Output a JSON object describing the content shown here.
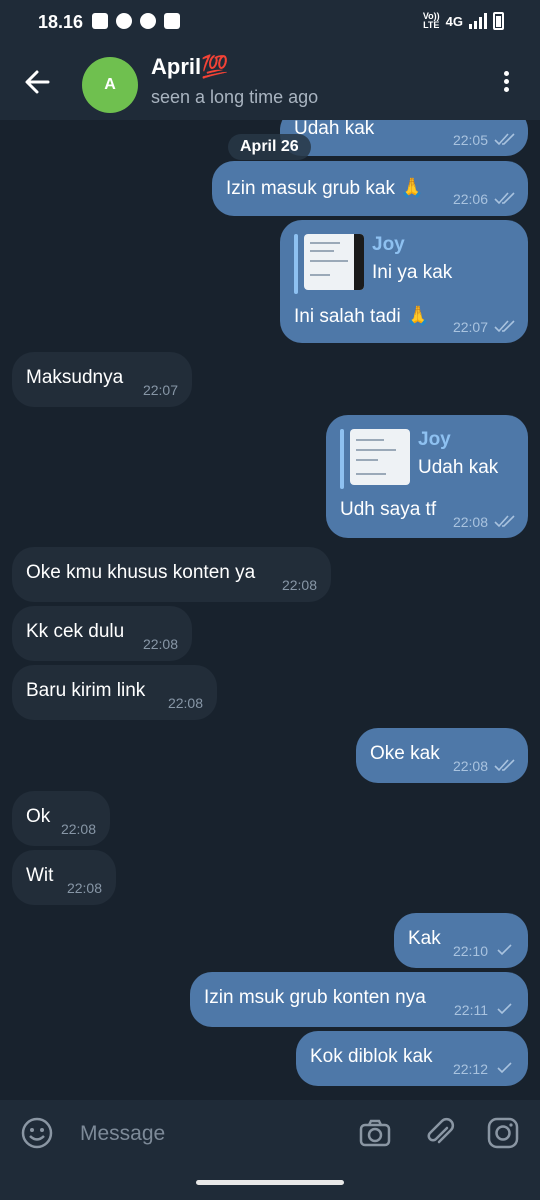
{
  "status_bar": {
    "time": "18.16",
    "volte_top": "Vo))",
    "volte_bottom": "LTE",
    "network": "4G"
  },
  "header": {
    "name": "April💯",
    "avatar_letter": "A",
    "avatar_color": "#6fc04f",
    "status": "seen a long time ago"
  },
  "chat": {
    "date_chip": "April 26",
    "messages": [
      {
        "dir": "out",
        "text": "Udah kak",
        "time": "22:05",
        "status": "read"
      },
      {
        "dir": "out",
        "text": "Izin masuk grub kak 🙏",
        "time": "22:06",
        "status": "read"
      },
      {
        "dir": "out",
        "reply_name": "Joy",
        "reply_text": "Ini ya kak",
        "text": "Ini salah tadi 🙏",
        "time": "22:07",
        "status": "read"
      },
      {
        "dir": "in",
        "text": "Maksudnya",
        "time": "22:07"
      },
      {
        "dir": "out",
        "reply_name": "Joy",
        "reply_text": "Udah kak",
        "text": "Udh saya tf",
        "time": "22:08",
        "status": "read"
      },
      {
        "dir": "in",
        "text": "Oke kmu khusus konten ya",
        "time": "22:08"
      },
      {
        "dir": "in",
        "text": "Kk cek dulu",
        "time": "22:08"
      },
      {
        "dir": "in",
        "text": "Baru kirim link",
        "time": "22:08"
      },
      {
        "dir": "out",
        "text": "Oke kak",
        "time": "22:08",
        "status": "read"
      },
      {
        "dir": "in",
        "text": "Ok",
        "time": "22:08"
      },
      {
        "dir": "in",
        "text": "Wit",
        "time": "22:08"
      },
      {
        "dir": "out",
        "text": "Kak",
        "time": "22:10",
        "status": "sent"
      },
      {
        "dir": "out",
        "text": "Izin msuk grub konten nya",
        "time": "22:11",
        "status": "sent"
      },
      {
        "dir": "out",
        "text": "Kok diblok kak",
        "time": "22:12",
        "status": "sent"
      }
    ]
  },
  "composer": {
    "placeholder": "Message"
  },
  "colors": {
    "background": "#18222d",
    "bar": "#1f2b38",
    "outgoing_bubble": "#4e78a8",
    "incoming_bubble": "#222d39",
    "accent": "#8ec1f1"
  },
  "icons": {
    "back": "arrow-left-icon",
    "menu": "more-vertical-icon",
    "emoji": "smiley-icon",
    "camera": "camera-icon",
    "attach": "paperclip-icon",
    "instagram": "instagram-icon",
    "read": "double-check-icon",
    "sent": "single-check-icon"
  }
}
